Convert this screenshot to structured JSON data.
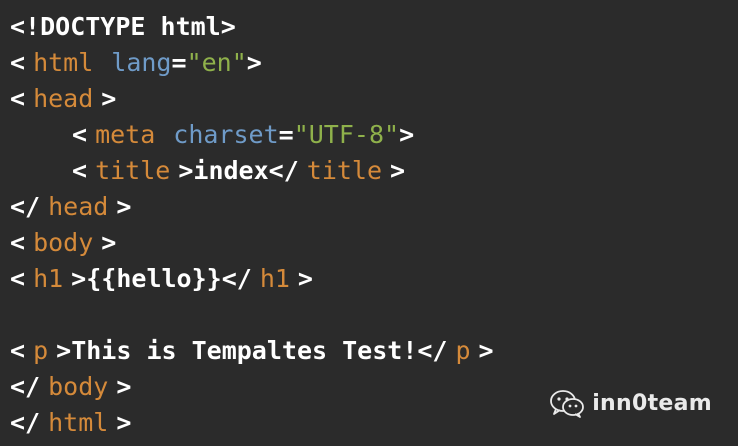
{
  "code": {
    "doctype": "<!DOCTYPE html>",
    "lt": "<",
    "gt": ">",
    "close_lt": "</",
    "html_tag": "html",
    "lang_attr": "lang",
    "eq": "=",
    "lang_value": "\"en\"",
    "head_tag": "head",
    "meta_tag": "meta",
    "charset_attr": "charset",
    "charset_value": "\"UTF-8\"",
    "title_tag": "title",
    "title_text": "index",
    "body_tag": "body",
    "h1_tag": "h1",
    "h1_text": "{{hello}}",
    "p_tag": "p",
    "p_text": "This is Tempaltes Test!"
  },
  "watermark": {
    "icon": "wechat-icon",
    "text": "inn0team"
  },
  "colors": {
    "background": "#2b2b2b",
    "tag": "#d58a3a",
    "attribute": "#6f9bc8",
    "string": "#8fb14b",
    "punctuation": "#ffffff"
  }
}
